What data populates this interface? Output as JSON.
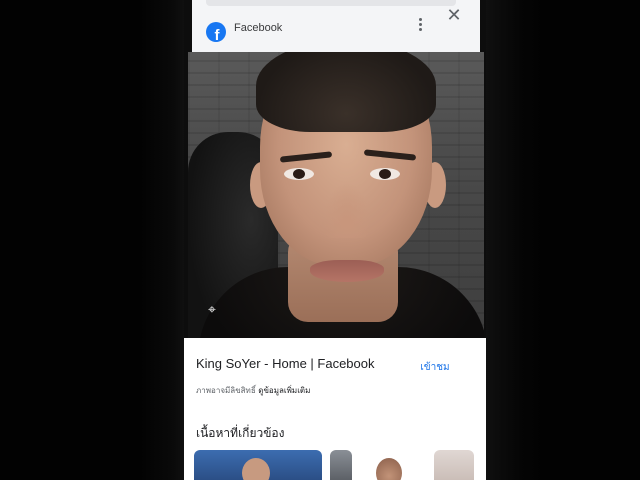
{
  "viewer_header": {
    "site_name": "Facebook",
    "logo_letter": "f",
    "menu_icon": "more-vert-icon",
    "close_icon": "close-icon"
  },
  "image_viewer": {
    "lens_icon": "lens-search-icon"
  },
  "result_card": {
    "title": "King SoYer - Home | Facebook",
    "visit_label": "เข้าชม",
    "copyright_note": "ภาพอาจมีลิขสิทธิ์",
    "more_info_link": "ดูข้อมูลเพิ่มเติม",
    "related_heading": "เนื้อหาที่เกี่ยวข้อง"
  },
  "colors": {
    "facebook_blue": "#1877f2",
    "link_blue": "#1a73e8",
    "header_bg": "#f4f5f7"
  }
}
